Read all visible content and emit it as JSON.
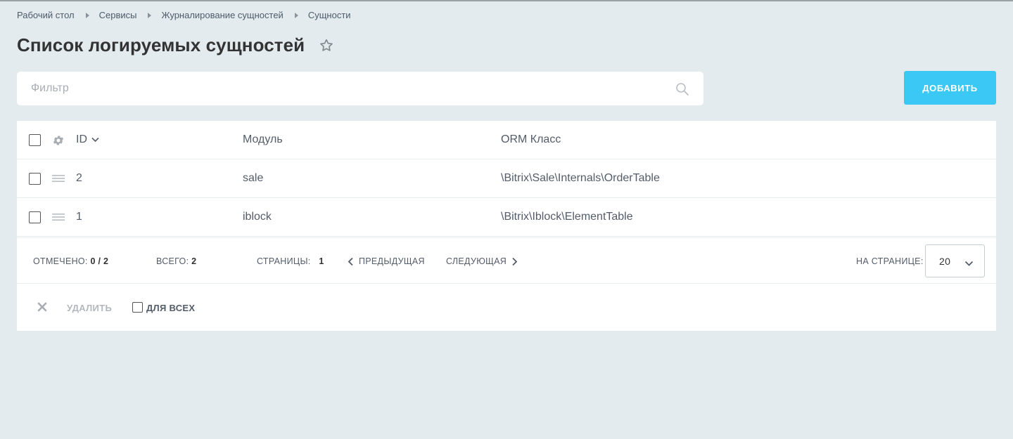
{
  "breadcrumbs": [
    "Рабочий стол",
    "Сервисы",
    "Журналирование сущностей",
    "Сущности"
  ],
  "page_title": "Список логируемых сущностей",
  "filter": {
    "placeholder": "Фильтр"
  },
  "add_button": "ДОБАВИТЬ",
  "table": {
    "columns": {
      "id": "ID",
      "module": "Модуль",
      "orm": "ORM Класс"
    },
    "rows": [
      {
        "id": "2",
        "module": "sale",
        "orm": "\\Bitrix\\Sale\\Internals\\OrderTable"
      },
      {
        "id": "1",
        "module": "iblock",
        "orm": "\\Bitrix\\Iblock\\ElementTable"
      }
    ]
  },
  "footer": {
    "checked_label": "ОТМЕЧЕНО:",
    "checked_value": "0 / 2",
    "total_label": "ВСЕГО:",
    "total_value": "2",
    "pages_label": "СТРАНИЦЫ:",
    "current_page": "1",
    "prev_label": "ПРЕДЫДУЩАЯ",
    "next_label": "СЛЕДУЮЩАЯ",
    "per_page_label": "НА СТРАНИЦЕ:",
    "per_page_value": "20"
  },
  "actions": {
    "delete_label": "УДАЛИТЬ",
    "for_all_label": "ДЛЯ ВСЕХ"
  },
  "colors": {
    "accent": "#3bc8f5",
    "background": "#e3ebee"
  },
  "icons": [
    "star-icon",
    "search-icon",
    "gear-icon",
    "drag-handle-icon",
    "chevron-down-icon",
    "chevron-left-icon",
    "chevron-right-icon",
    "close-icon"
  ]
}
